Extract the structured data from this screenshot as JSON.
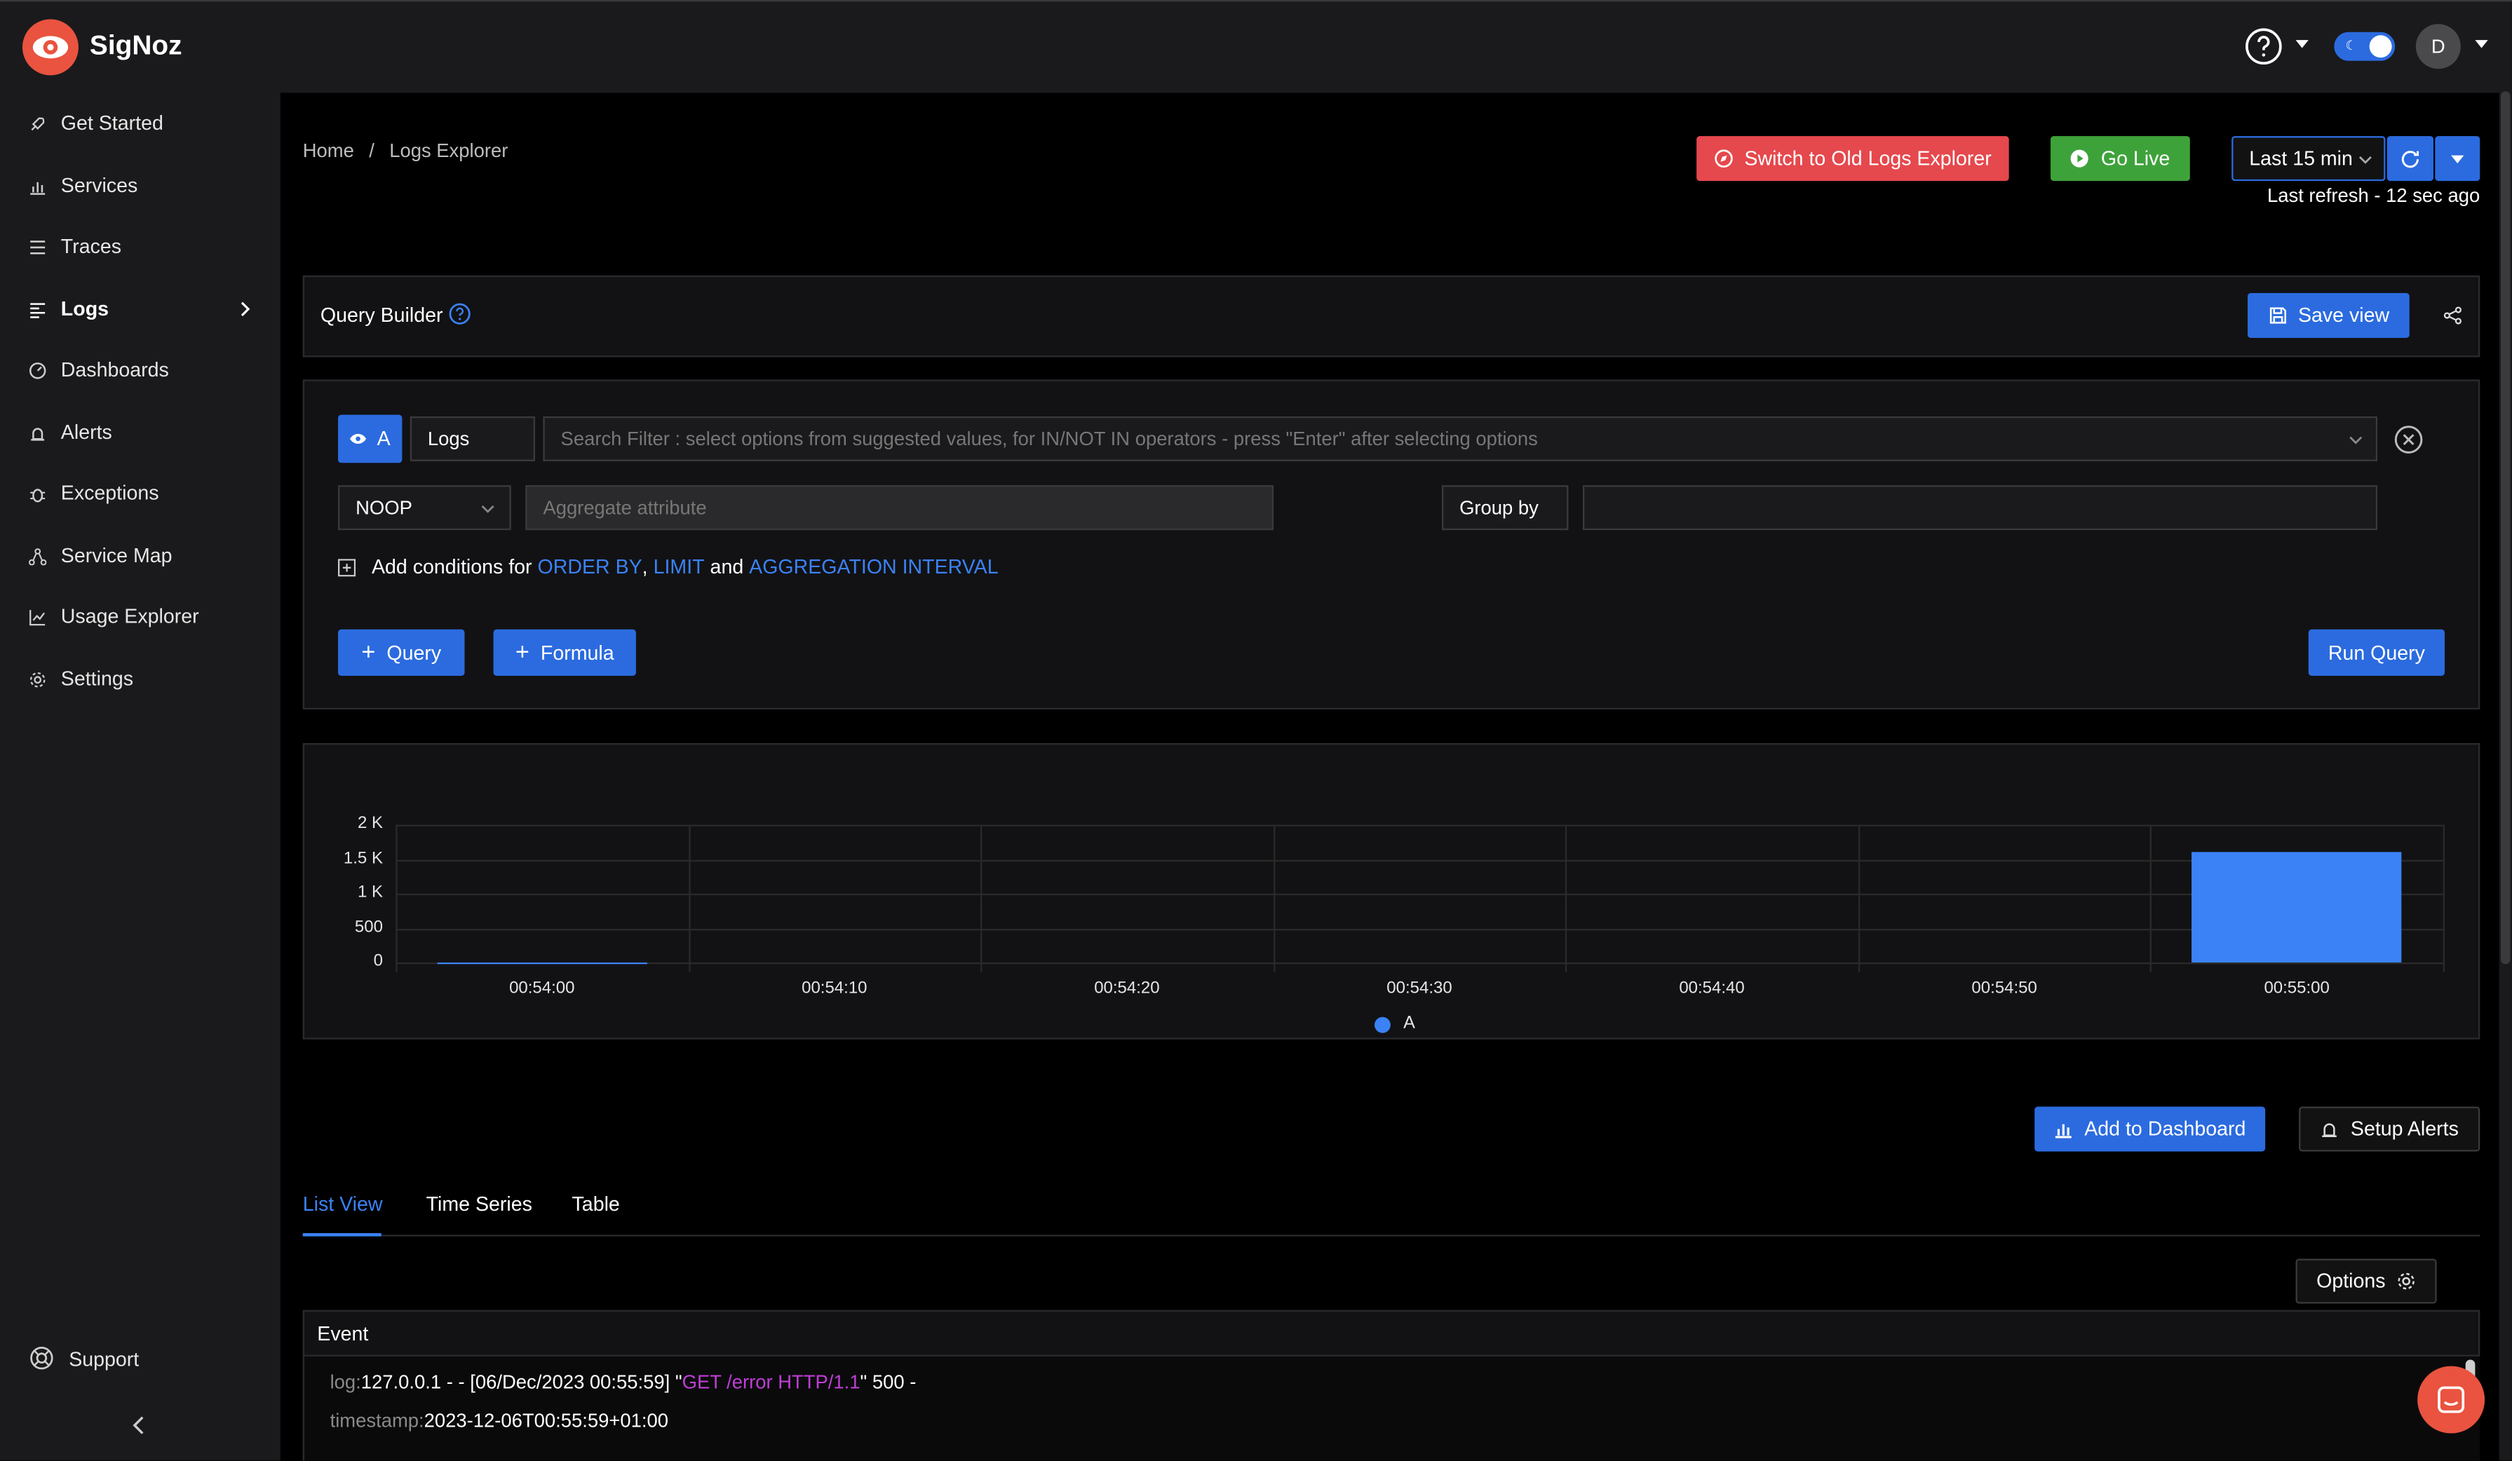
{
  "app": {
    "name": "SigNoz"
  },
  "header": {
    "avatar_initial": "D",
    "help_icon": "question-circle-icon",
    "theme_toggle_icon": "moon-icon"
  },
  "sidebar": {
    "items": [
      {
        "label": "Get Started",
        "icon": "rocket-icon"
      },
      {
        "label": "Services",
        "icon": "bar-chart-icon"
      },
      {
        "label": "Traces",
        "icon": "list-icon"
      },
      {
        "label": "Logs",
        "icon": "align-left-icon"
      },
      {
        "label": "Dashboards",
        "icon": "dashboard-icon"
      },
      {
        "label": "Alerts",
        "icon": "alarm-icon"
      },
      {
        "label": "Exceptions",
        "icon": "bug-icon"
      },
      {
        "label": "Service Map",
        "icon": "deployment-icon"
      },
      {
        "label": "Usage Explorer",
        "icon": "line-chart-icon"
      },
      {
        "label": "Settings",
        "icon": "gear-icon"
      }
    ],
    "support_label": "Support"
  },
  "breadcrumb": {
    "home": "Home",
    "separator": "/",
    "current": "Logs Explorer"
  },
  "toolbar": {
    "switch_old_label": "Switch to Old Logs Explorer",
    "go_live_label": "Go Live",
    "time_range": "Last 15 min",
    "last_refresh": "Last refresh - 12 sec ago"
  },
  "query_builder": {
    "title": "Query Builder",
    "save_view_label": "Save view",
    "query_letter": "A",
    "data_source": "Logs",
    "search_placeholder": "Search Filter : select options from suggested values, for IN/NOT IN operators - press \"Enter\" after selecting options",
    "aggregate_operator": "NOOP",
    "aggregate_placeholder": "Aggregate attribute",
    "group_by_label": "Group by",
    "conditions_prefix": "Add conditions for",
    "order_by": "ORDER BY",
    "comma": ",",
    "limit": "LIMIT",
    "and": "and",
    "aggregation_interval": "AGGREGATION INTERVAL",
    "add_query_label": "Query",
    "add_formula_label": "Formula",
    "run_query_label": "Run Query"
  },
  "chart_data": {
    "type": "bar",
    "title": "",
    "xlabel": "",
    "ylabel": "",
    "ylim": [
      0,
      2000
    ],
    "y_ticks": [
      "2 K",
      "1.5 K",
      "1 K",
      "500",
      "0"
    ],
    "x_ticks": [
      "00:54:00",
      "00:54:10",
      "00:54:20",
      "00:54:30",
      "00:54:40",
      "00:54:50",
      "00:55:00"
    ],
    "series": [
      {
        "name": "A",
        "color": "#3b82f6",
        "bars": [
          {
            "x": "00:54:00",
            "value": 10
          },
          {
            "x": "00:55:00",
            "value": 1600
          }
        ]
      }
    ],
    "legend": "bottom-center",
    "grid": true
  },
  "actions": {
    "add_dashboard_label": "Add to Dashboard",
    "setup_alerts_label": "Setup Alerts"
  },
  "tabs": [
    {
      "label": "List View",
      "active": true
    },
    {
      "label": "Time Series"
    },
    {
      "label": "Table"
    }
  ],
  "options_label": "Options",
  "table": {
    "column": "Event",
    "rows": [
      {
        "log_key": "log:",
        "log_prefix": "127.0.0.1 - - [06/Dec/2023 00:55:59] \"",
        "log_highlight": "GET /error HTTP/1.1",
        "log_suffix": "\" 500 -",
        "timestamp_key": "timestamp:",
        "timestamp_value": "2023-12-06T00:55:59+01:00"
      }
    ]
  },
  "colors": {
    "brand": "#e9533f",
    "primary": "#2b6bdf",
    "danger": "#e5484d",
    "success": "#3ea23a",
    "highlight": "#c03ed6"
  }
}
